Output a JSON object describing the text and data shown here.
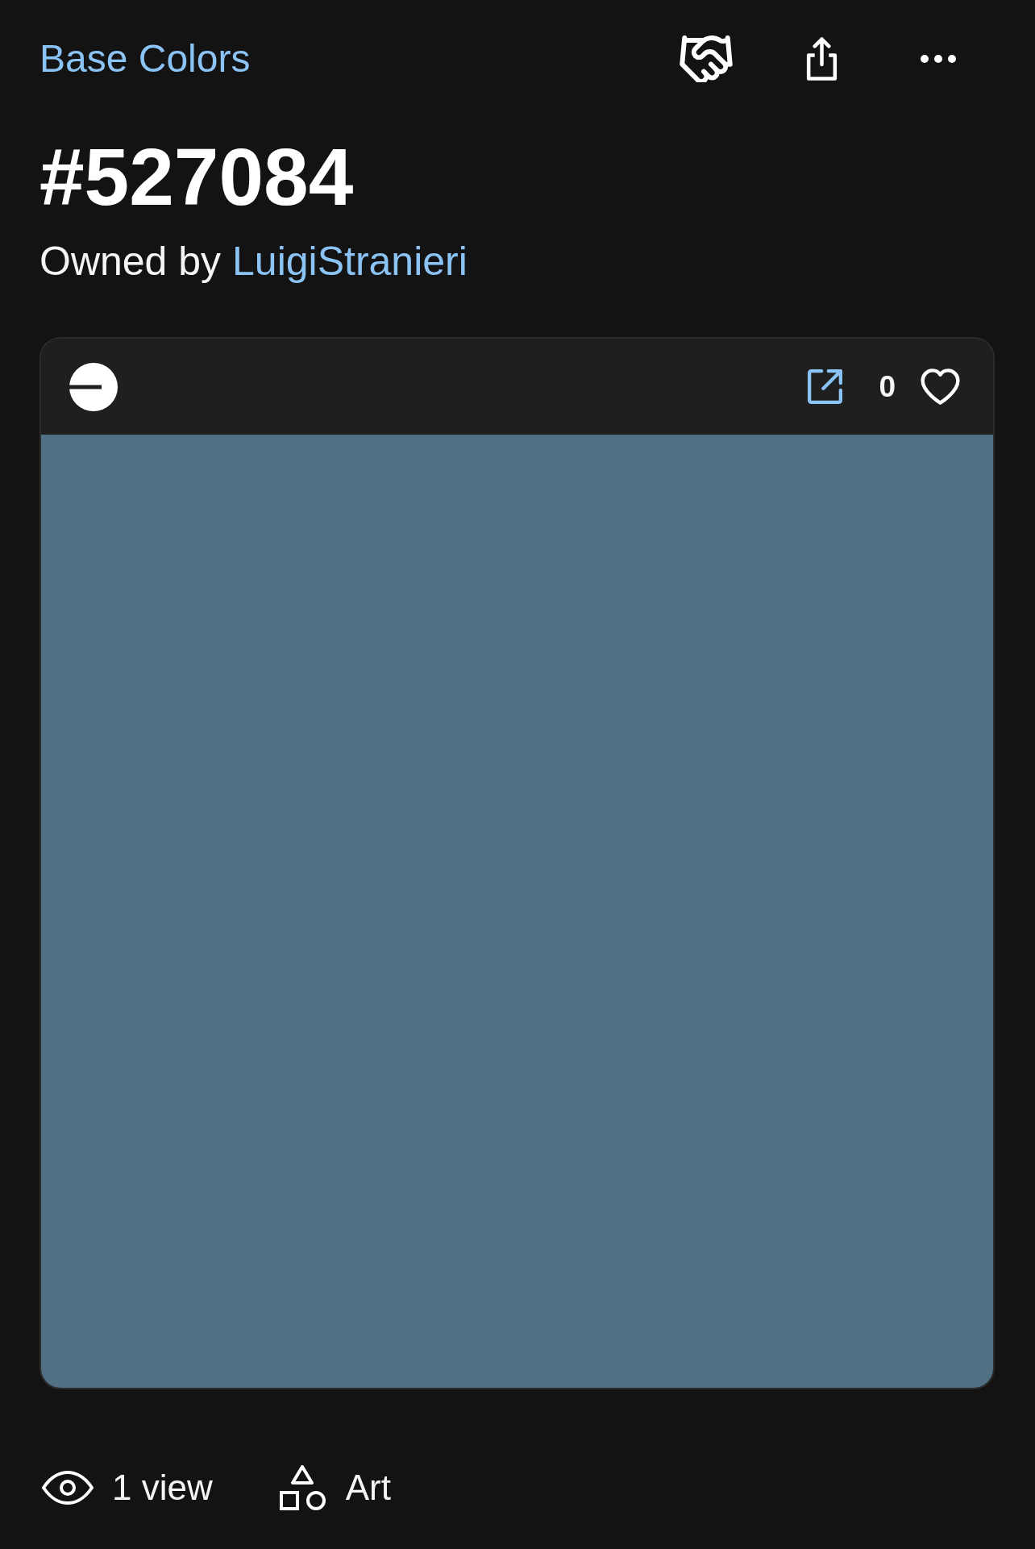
{
  "collection": "Base Colors",
  "title": "#527084",
  "owner": {
    "label": "Owned by",
    "name": "LuigiStranieri"
  },
  "card": {
    "like_count": "0",
    "liked": false,
    "swatch": {
      "color": "#527084"
    }
  },
  "footer": {
    "views": "1 view",
    "category": "Art"
  }
}
